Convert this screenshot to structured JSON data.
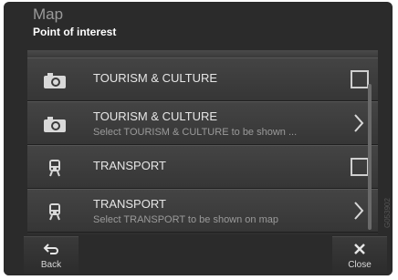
{
  "header": {
    "app_title": "Map",
    "subtitle": "Point of interest"
  },
  "list": [
    {
      "label": "TOURISM & CULTURE",
      "sub": "",
      "icon": "camera-icon",
      "control": "checkbox"
    },
    {
      "label": "TOURISM & CULTURE",
      "sub": "Select TOURISM & CULTURE to be shown ...",
      "icon": "camera-icon",
      "control": "chevron"
    },
    {
      "label": "TRANSPORT",
      "sub": "",
      "icon": "train-icon",
      "control": "checkbox"
    },
    {
      "label": "TRANSPORT",
      "sub": "Select TRANSPORT to be shown on map",
      "icon": "train-icon",
      "control": "chevron"
    }
  ],
  "footer": {
    "back_label": "Back",
    "close_label": "Close"
  },
  "image_code": "G053902"
}
